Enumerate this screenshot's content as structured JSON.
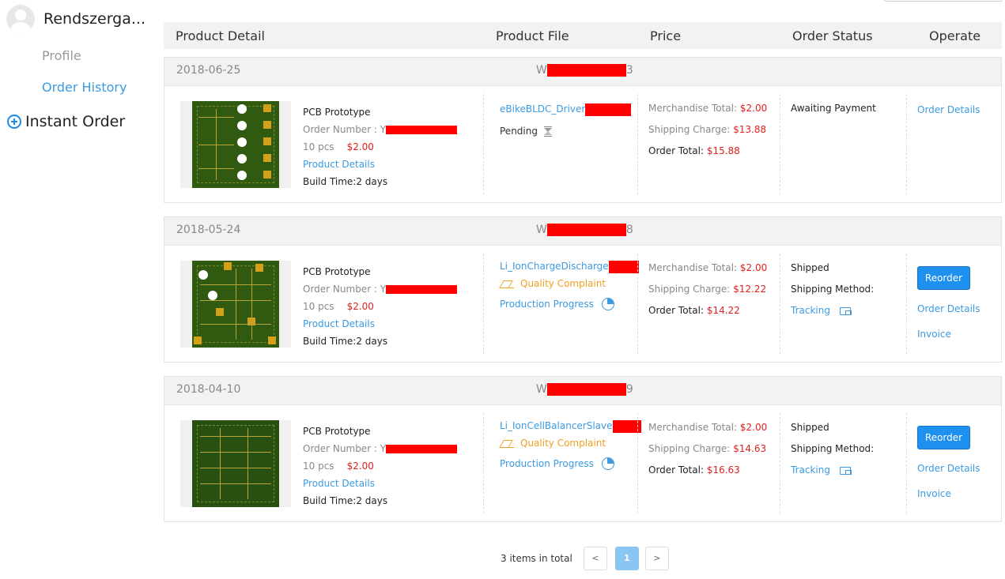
{
  "user": {
    "name": "Rendszerga..."
  },
  "sidebar": {
    "profile": "Profile",
    "order_history": "Order History",
    "instant_order": "Instant Order"
  },
  "table_header": {
    "product_detail": "Product Detail",
    "product_file": "Product File",
    "price": "Price",
    "order_status": "Order Status",
    "operate": "Operate"
  },
  "orders": [
    {
      "date": "2018-06-25",
      "order_id_prefix": "W",
      "order_id_suffix": "3",
      "product_title": "PCB Prototype",
      "order_number_label": "Order Number : Y",
      "qty": "10 pcs",
      "unit_price": "$2.00",
      "product_details": "Product Details",
      "build_time": "Build Time:2 days",
      "file_name": "eBikeBLDC_Driver",
      "file_status": "Pending",
      "merch_label": "Merchandise Total:",
      "merch_value": "$2.00",
      "ship_label": "Shipping Charge:",
      "ship_value": "$13.88",
      "total_label": "Order Total:",
      "total_value": "$15.88",
      "status": "Awaiting Payment",
      "order_details": "Order Details"
    },
    {
      "date": "2018-05-24",
      "order_id_prefix": "W",
      "order_id_suffix": "8",
      "product_title": "PCB Prototype",
      "order_number_label": "Order Number : Y",
      "qty": "10 pcs",
      "unit_price": "$2.00",
      "product_details": "Product Details",
      "build_time": "Build Time:2 days",
      "file_name": "Li_IonChargeDischarge",
      "quality_complaint": "Quality Complaint",
      "production_progress": "Production Progress",
      "merch_label": "Merchandise Total:",
      "merch_value": "$2.00",
      "ship_label": "Shipping Charge:",
      "ship_value": "$12.22",
      "total_label": "Order Total:",
      "total_value": "$14.22",
      "status": "Shipped",
      "shipping_method": "Shipping Method:",
      "tracking": "Tracking",
      "reorder": "Reorder",
      "order_details": "Order Details",
      "invoice": "Invoice"
    },
    {
      "date": "2018-04-10",
      "order_id_prefix": "W",
      "order_id_suffix": "9",
      "product_title": "PCB Prototype",
      "order_number_label": "Order Number : Y",
      "qty": "10 pcs",
      "unit_price": "$2.00",
      "product_details": "Product Details",
      "build_time": "Build Time:2 days",
      "file_name": "Li_IonCellBalancerSlave",
      "quality_complaint": "Quality Complaint",
      "production_progress": "Production Progress",
      "merch_label": "Merchandise Total:",
      "merch_value": "$2.00",
      "ship_label": "Shipping Charge:",
      "ship_value": "$14.63",
      "total_label": "Order Total:",
      "total_value": "$16.63",
      "status": "Shipped",
      "shipping_method": "Shipping Method:",
      "tracking": "Tracking",
      "reorder": "Reorder",
      "order_details": "Order Details",
      "invoice": "Invoice"
    }
  ],
  "pagination": {
    "total_text": "3 items in total",
    "prev": "<",
    "current": "1",
    "next": ">"
  },
  "icons": {
    "avatar": "user-avatar-icon",
    "instant": "plus-circle-icon",
    "pending": "hourglass-icon",
    "complaint": "quality-complaint-icon",
    "progress": "progress-pie-icon",
    "tracking": "truck-icon"
  },
  "colors": {
    "link": "#3b9ae1",
    "price_red": "#e02020",
    "warning": "#f0a020",
    "button_blue": "#1e90f0"
  }
}
